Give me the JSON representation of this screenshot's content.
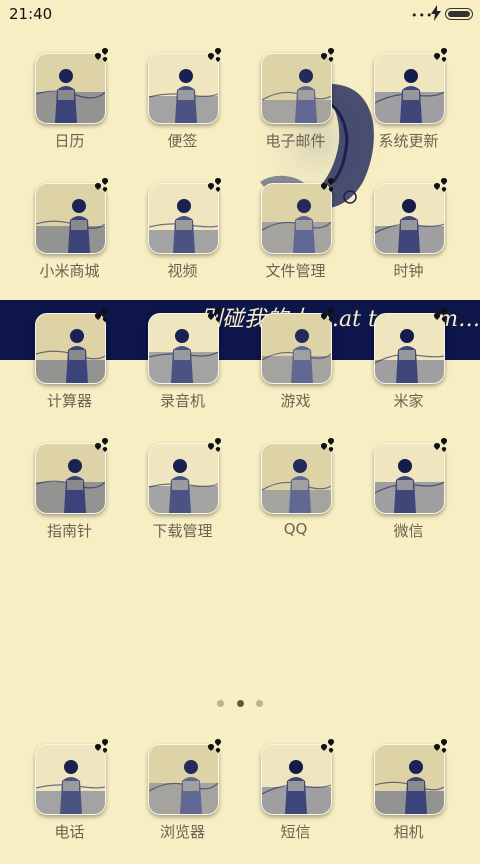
{
  "status": {
    "time": "21:40",
    "signal_icon": "more-dots-icon",
    "charging_icon": "bolt-icon",
    "battery_icon": "battery-icon"
  },
  "banner": {
    "text": "别碰我的人  …at to my m…"
  },
  "apps": [
    {
      "name": "calendar",
      "label": "日历",
      "icon": "photo-icon"
    },
    {
      "name": "notes",
      "label": "便签",
      "icon": "photo-icon"
    },
    {
      "name": "email",
      "label": "电子邮件",
      "icon": "photo-icon"
    },
    {
      "name": "system-update",
      "label": "系统更新",
      "icon": "photo-icon"
    },
    {
      "name": "mi-store",
      "label": "小米商城",
      "icon": "photo-icon"
    },
    {
      "name": "video",
      "label": "视频",
      "icon": "photo-icon"
    },
    {
      "name": "file-manager",
      "label": "文件管理",
      "icon": "photo-icon"
    },
    {
      "name": "clock",
      "label": "时钟",
      "icon": "photo-icon"
    },
    {
      "name": "calculator",
      "label": "计算器",
      "icon": "photo-icon"
    },
    {
      "name": "recorder",
      "label": "录音机",
      "icon": "photo-icon"
    },
    {
      "name": "games",
      "label": "游戏",
      "icon": "photo-icon"
    },
    {
      "name": "mi-home",
      "label": "米家",
      "icon": "photo-icon"
    },
    {
      "name": "compass",
      "label": "指南针",
      "icon": "photo-icon"
    },
    {
      "name": "downloads",
      "label": "下载管理",
      "icon": "photo-icon"
    },
    {
      "name": "qq",
      "label": "QQ",
      "icon": "photo-icon"
    },
    {
      "name": "wechat",
      "label": "微信",
      "icon": "photo-icon"
    }
  ],
  "dock": [
    {
      "name": "phone",
      "label": "电话",
      "icon": "photo-icon"
    },
    {
      "name": "browser",
      "label": "浏览器",
      "icon": "photo-icon"
    },
    {
      "name": "messages",
      "label": "短信",
      "icon": "photo-icon"
    },
    {
      "name": "camera",
      "label": "相机",
      "icon": "photo-icon"
    }
  ],
  "pager": {
    "pages": 3,
    "current": 2
  },
  "colors": {
    "background": "#f7efc3",
    "banner": "#0d154a",
    "label": "#6b6452",
    "ink": "#1a2150"
  }
}
